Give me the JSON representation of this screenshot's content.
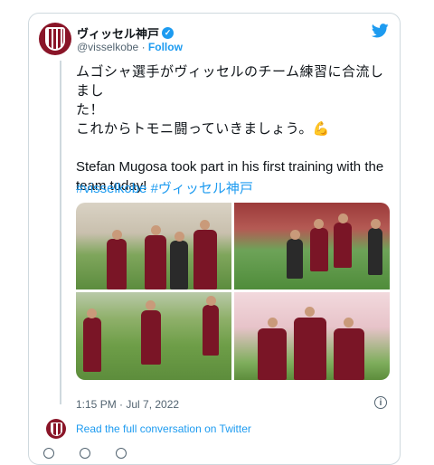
{
  "tweet": {
    "author_name": "ヴィッセル神戸",
    "author_handle": "@visselkobe",
    "separator": "·",
    "follow_label": "Follow",
    "text_jp_line1": "ムゴシャ選手がヴィッセルのチーム練習に合流しまし",
    "text_jp_line2": "た！",
    "text_jp_line3": "これからトモニ闘っていきましょう。💪",
    "text_en": "Stefan Mugosa took part in his first training with the team today!",
    "hashtags": [
      "#visselkobe",
      "#ヴィッセル神戸"
    ],
    "timestamp": "1:15 PM · Jul 7, 2022",
    "conversation_link": "Read the full conversation on Twitter"
  },
  "icons": {
    "verified": "verified-badge-icon",
    "bird": "twitter-bird-icon",
    "info": "info-icon"
  },
  "colors": {
    "accent": "#1d9bf0",
    "club": "#8a1528",
    "muted": "#536471"
  }
}
